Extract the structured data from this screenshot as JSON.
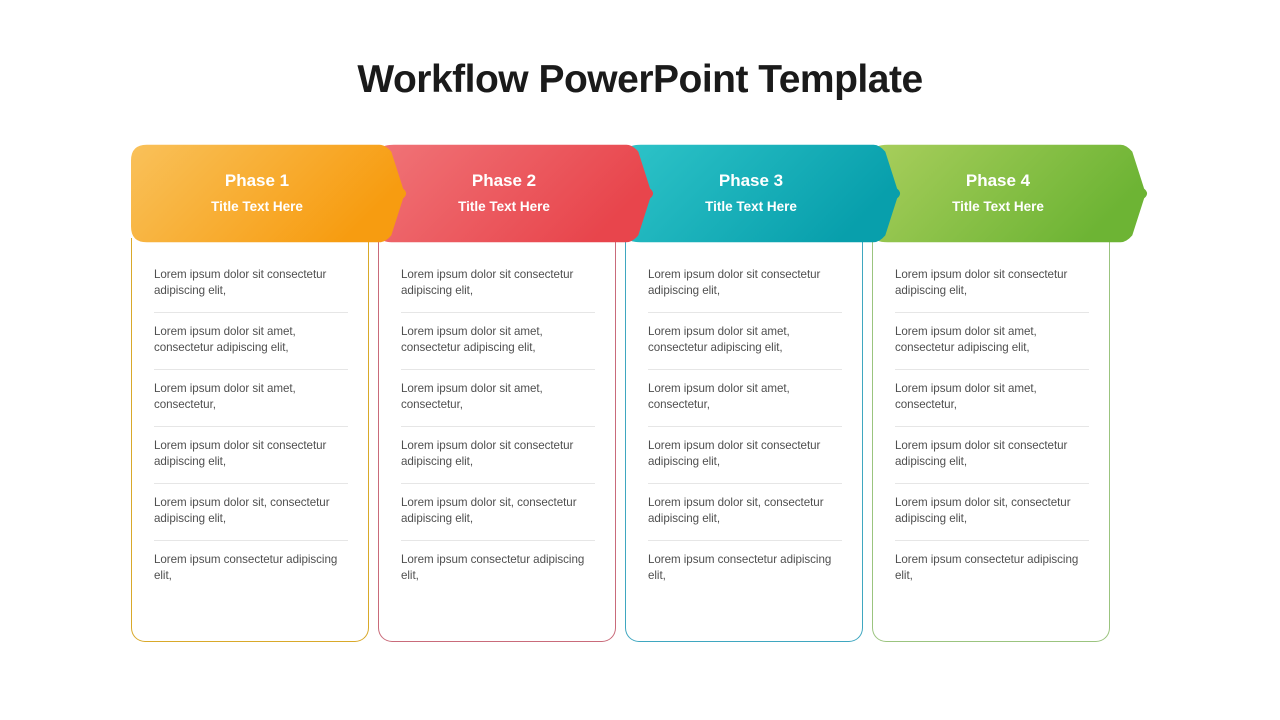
{
  "slide": {
    "title": "Workflow PowerPoint Template",
    "background_color": "#ffffff",
    "body_text_color": "#4f4f4f",
    "divider_color": "#e6e6e6"
  },
  "phases": [
    {
      "phase_label": "Phase 1",
      "subtitle": "Title Text Here",
      "gradient_from": "#F9C15A",
      "gradient_to": "#F79C10",
      "border_color": "#D9A92A",
      "items": [
        "Lorem ipsum dolor sit consectetur adipiscing elit,",
        "Lorem ipsum dolor sit amet, consectetur adipiscing elit,",
        "Lorem ipsum dolor sit amet, consectetur,",
        "Lorem ipsum dolor sit consectetur adipiscing elit,",
        "Lorem ipsum dolor sit, consectetur adipiscing elit,",
        "Lorem ipsum consectetur adipiscing elit,"
      ]
    },
    {
      "phase_label": "Phase 2",
      "subtitle": "Title Text Here",
      "gradient_from": "#F07377",
      "gradient_to": "#E8454C",
      "border_color": "#C96B7A",
      "items": [
        "Lorem ipsum dolor sit consectetur adipiscing elit,",
        "Lorem ipsum dolor sit amet, consectetur adipiscing elit,",
        "Lorem ipsum dolor sit amet, consectetur,",
        "Lorem ipsum dolor sit consectetur adipiscing elit,",
        "Lorem ipsum dolor sit, consectetur adipiscing elit,",
        "Lorem ipsum consectetur adipiscing elit,"
      ]
    },
    {
      "phase_label": "Phase 3",
      "subtitle": "Title Text Here",
      "gradient_from": "#2DC3C8",
      "gradient_to": "#089FAC",
      "border_color": "#3FA7C0",
      "items": [
        "Lorem ipsum dolor sit consectetur adipiscing elit,",
        "Lorem ipsum dolor sit amet, consectetur adipiscing elit,",
        "Lorem ipsum dolor sit amet, consectetur,",
        "Lorem ipsum dolor sit consectetur adipiscing elit,",
        "Lorem ipsum dolor sit, consectetur adipiscing elit,",
        "Lorem ipsum consectetur adipiscing elit,"
      ]
    },
    {
      "phase_label": "Phase 4",
      "subtitle": "Title Text Here",
      "gradient_from": "#A8CE5C",
      "gradient_to": "#6DB434",
      "border_color": "#9BC47F",
      "items": [
        "Lorem ipsum dolor sit consectetur adipiscing elit,",
        "Lorem ipsum dolor sit amet, consectetur adipiscing elit,",
        "Lorem ipsum dolor sit amet, consectetur,",
        "Lorem ipsum dolor sit consectetur adipiscing elit,",
        "Lorem ipsum dolor sit, consectetur adipiscing elit,",
        "Lorem ipsum consectetur adipiscing elit,"
      ]
    }
  ]
}
